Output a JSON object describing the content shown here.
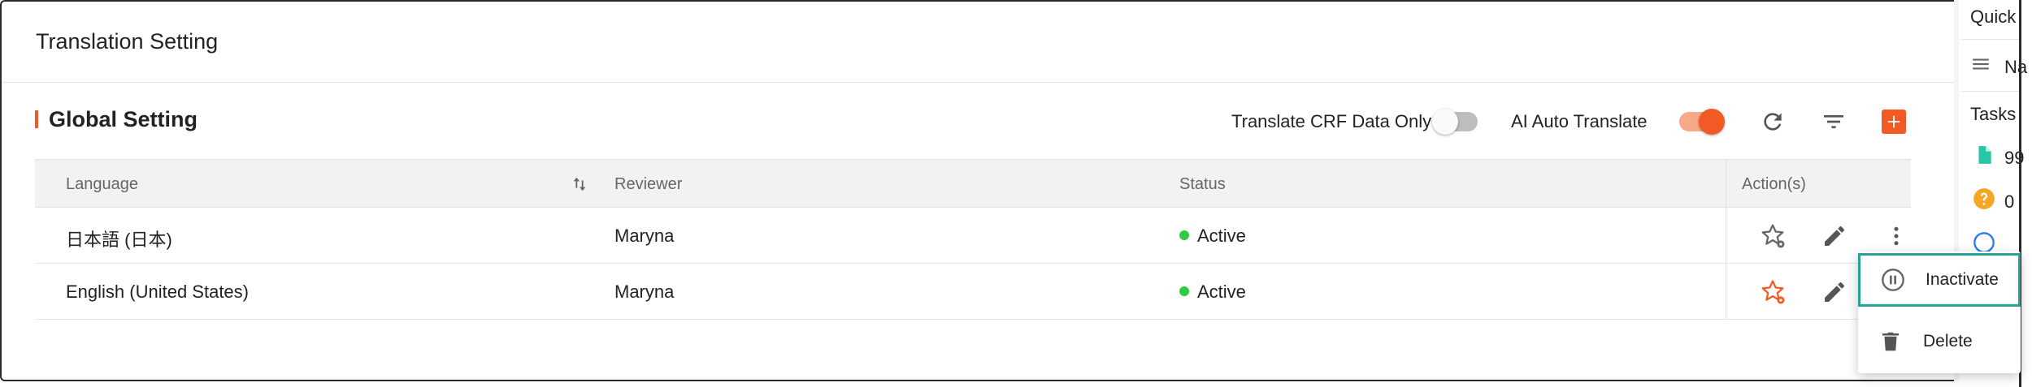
{
  "page": {
    "title": "Translation Setting"
  },
  "section": {
    "title": "Global Setting"
  },
  "toolbar": {
    "translate_crf_label": "Translate CRF Data Only",
    "translate_crf_on": false,
    "ai_auto_label": "AI Auto Translate",
    "ai_auto_on": true,
    "icons": [
      "refresh-icon",
      "filter-icon",
      "add-icon"
    ]
  },
  "table": {
    "headers": {
      "language": "Language",
      "reviewer": "Reviewer",
      "status": "Status",
      "actions": "Action(s)"
    },
    "rows": [
      {
        "language": "日本語 (日本)",
        "reviewer": "Maryna",
        "status": "Active",
        "default": false
      },
      {
        "language": "English (United States)",
        "reviewer": "Maryna",
        "status": "Active",
        "default": true
      }
    ]
  },
  "menu": {
    "items": [
      {
        "label": "Inactivate",
        "icon": "pause-circle-icon"
      },
      {
        "label": "Delete",
        "icon": "trash-icon"
      }
    ]
  },
  "side": {
    "quick": "Quick",
    "nav": "Na",
    "tasks": "Tasks",
    "task_count_1": "99",
    "task_count_2": "0"
  },
  "colors": {
    "accent": "#f15a24",
    "active_status": "#2ecc40",
    "highlight_border": "#2aa198",
    "teal_doc": "#26c6a6",
    "warning": "#f5a623",
    "info": "#2d7be5"
  }
}
